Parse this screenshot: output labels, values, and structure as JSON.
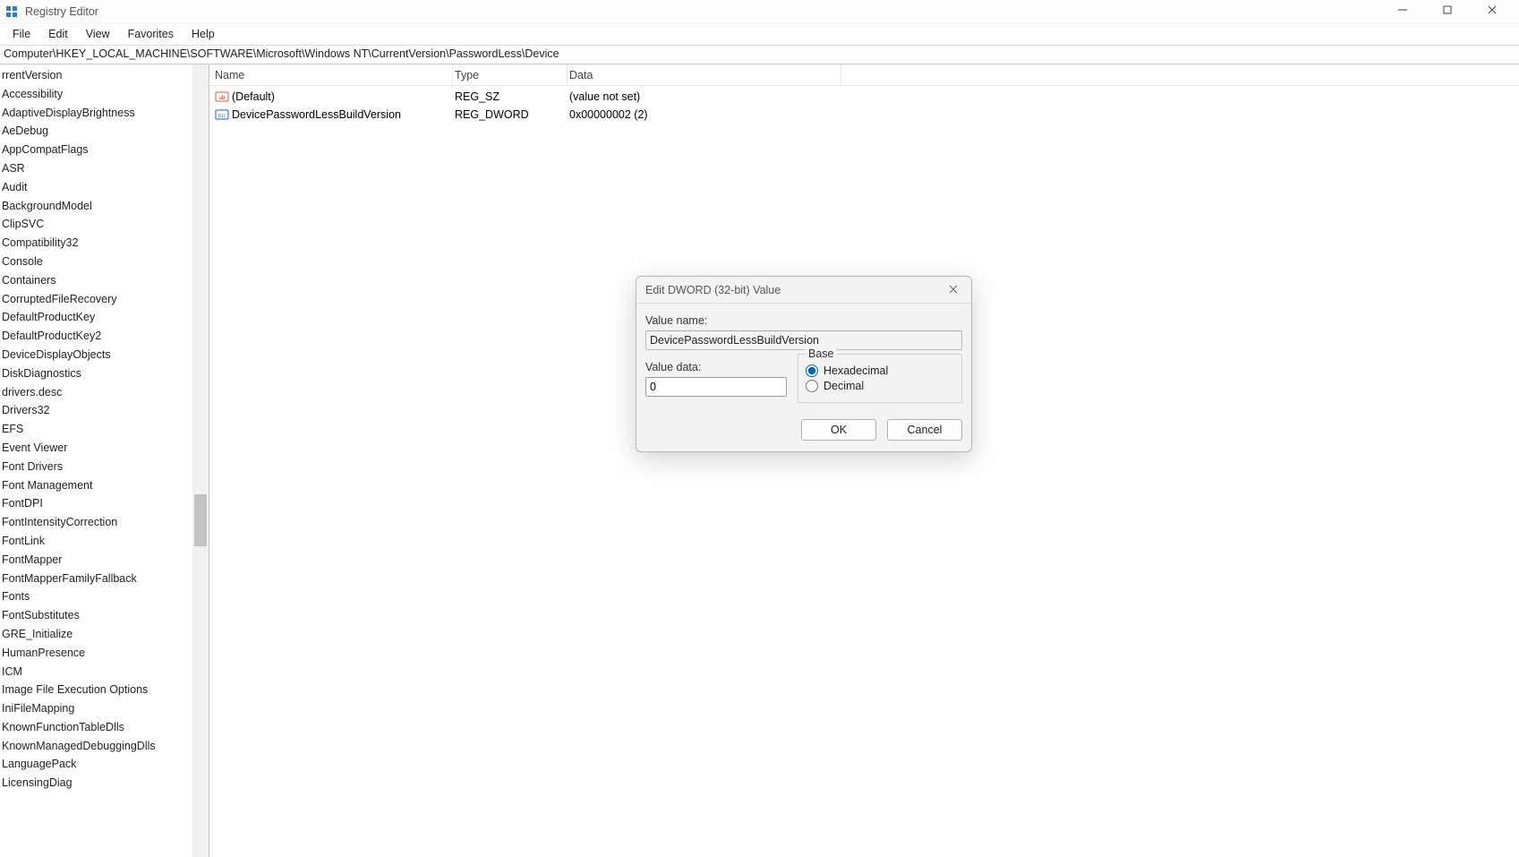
{
  "window": {
    "title": "Registry Editor"
  },
  "menu": {
    "file": "File",
    "edit": "Edit",
    "view": "View",
    "favorites": "Favorites",
    "help": "Help"
  },
  "address": "Computer\\HKEY_LOCAL_MACHINE\\SOFTWARE\\Microsoft\\Windows NT\\CurrentVersion\\PasswordLess\\Device",
  "tree": {
    "items": [
      "rrentVersion",
      "Accessibility",
      "AdaptiveDisplayBrightness",
      "AeDebug",
      "AppCompatFlags",
      "ASR",
      "Audit",
      "BackgroundModel",
      "ClipSVC",
      "Compatibility32",
      "Console",
      "Containers",
      "CorruptedFileRecovery",
      "DefaultProductKey",
      "DefaultProductKey2",
      "DeviceDisplayObjects",
      "DiskDiagnostics",
      "drivers.desc",
      "Drivers32",
      "EFS",
      "Event Viewer",
      "Font Drivers",
      "Font Management",
      "FontDPI",
      "FontIntensityCorrection",
      "FontLink",
      "FontMapper",
      "FontMapperFamilyFallback",
      "Fonts",
      "FontSubstitutes",
      "GRE_Initialize",
      "HumanPresence",
      "ICM",
      "Image File Execution Options",
      "IniFileMapping",
      "KnownFunctionTableDlls",
      "KnownManagedDebuggingDlls",
      "LanguagePack",
      "LicensingDiag"
    ]
  },
  "list": {
    "headers": {
      "name": "Name",
      "type": "Type",
      "data": "Data"
    },
    "rows": [
      {
        "name": "(Default)",
        "type": "REG_SZ",
        "data": "(value not set)",
        "icon": "string"
      },
      {
        "name": "DevicePasswordLessBuildVersion",
        "type": "REG_DWORD",
        "data": "0x00000002 (2)",
        "icon": "binary"
      }
    ]
  },
  "dialog": {
    "title": "Edit DWORD (32-bit) Value",
    "valueNameLabel": "Value name:",
    "valueName": "DevicePasswordLessBuildVersion",
    "valueDataLabel": "Value data:",
    "valueData": "0",
    "baseLabel": "Base",
    "hexLabel": "Hexadecimal",
    "decLabel": "Decimal",
    "okLabel": "OK",
    "cancelLabel": "Cancel"
  }
}
